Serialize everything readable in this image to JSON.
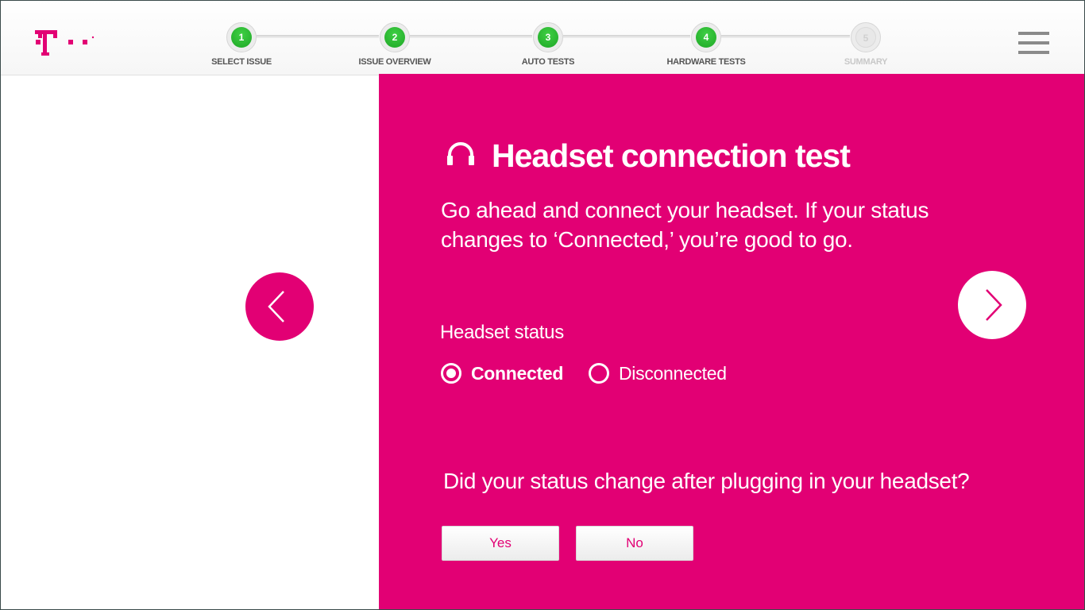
{
  "brand": {
    "logo_icon": "t-mobile-logo",
    "accent_color": "#e20074"
  },
  "stepper": {
    "steps": [
      {
        "number": "1",
        "label": "SELECT ISSUE",
        "state": "complete"
      },
      {
        "number": "2",
        "label": "ISSUE OVERVIEW",
        "state": "complete"
      },
      {
        "number": "3",
        "label": "AUTO TESTS",
        "state": "complete"
      },
      {
        "number": "4",
        "label": "HARDWARE TESTS",
        "state": "complete"
      },
      {
        "number": "5",
        "label": "SUMMARY",
        "state": "pending"
      }
    ],
    "complete_color": "#27b52e"
  },
  "header": {
    "menu_icon": "hamburger-menu-icon"
  },
  "navigation": {
    "prev_icon": "chevron-left-icon",
    "next_icon": "chevron-right-icon"
  },
  "test": {
    "icon": "headset-icon",
    "title": "Headset connection test",
    "description": "Go ahead and connect your headset. If your status changes to ‘Connected,’ you’re good to go.",
    "status_label": "Headset status",
    "status_options": [
      {
        "label": "Connected",
        "selected": true
      },
      {
        "label": "Disconnected",
        "selected": false
      }
    ],
    "question": "Did your status change after plugging in your headset?",
    "yes_label": "Yes",
    "no_label": "No"
  }
}
